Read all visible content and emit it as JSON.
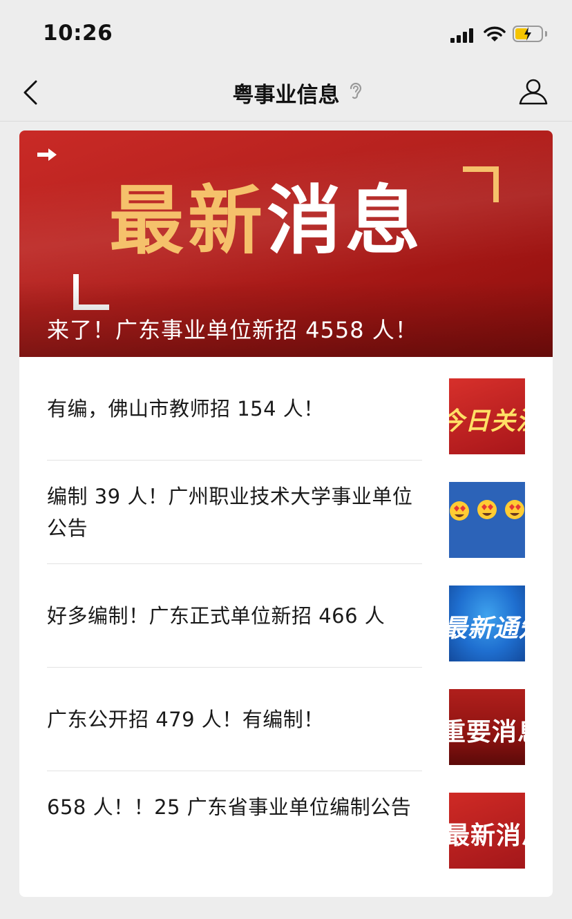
{
  "status_bar": {
    "time": "10:26"
  },
  "nav": {
    "title": "粤事业信息"
  },
  "banner": {
    "headline_part1": "最新",
    "headline_part2": "消息",
    "caption": "来了！广东事业单位新招 4558 人！"
  },
  "articles": [
    {
      "title": "有编，佛山市教师招 154 人！",
      "thumb_text": "今日关注"
    },
    {
      "title": "编制 39 人！广州职业技术大学事业单位公告",
      "thumb_text": ""
    },
    {
      "title": "好多编制！广东正式单位新招 466 人",
      "thumb_text": "最新通知"
    },
    {
      "title": "广东公开招 479 人！有编制！",
      "thumb_text": "重要消息"
    },
    {
      "title": "658 人！！25 广东省事业单位编制公告",
      "thumb_text": "最新消息"
    }
  ],
  "colors": {
    "banner_red": "#b3201d",
    "headline_gold": "#f5c16b",
    "battery": "#f5c400"
  }
}
